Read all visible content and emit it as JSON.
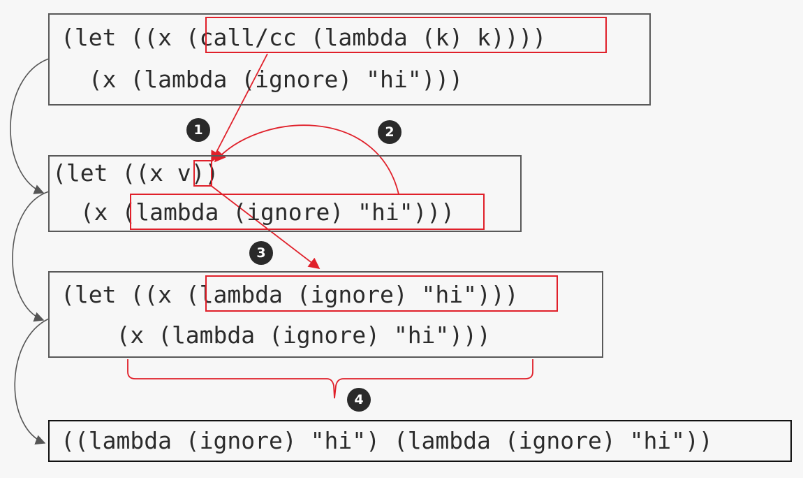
{
  "colors": {
    "highlight": "#e0202a",
    "box_border": "#595959",
    "text": "#2b2b2b",
    "badge": "#2a2a2a",
    "background": "#f7f7f7"
  },
  "steps": [
    {
      "line1": "(let ((x (call/cc (lambda (k) k))))",
      "line2": "  (x (lambda (ignore) \"hi\")))"
    },
    {
      "line1": "(let ((x v))",
      "line2": "  (x (lambda (ignore) \"hi\")))"
    },
    {
      "line1": "(let ((x (lambda (ignore) \"hi\")))",
      "line2": "    (x (lambda (ignore) \"hi\")))"
    },
    {
      "line1": "((lambda (ignore) \"hi\") (lambda (ignore) \"hi\"))"
    }
  ],
  "badges": [
    "1",
    "2",
    "3",
    "4"
  ]
}
